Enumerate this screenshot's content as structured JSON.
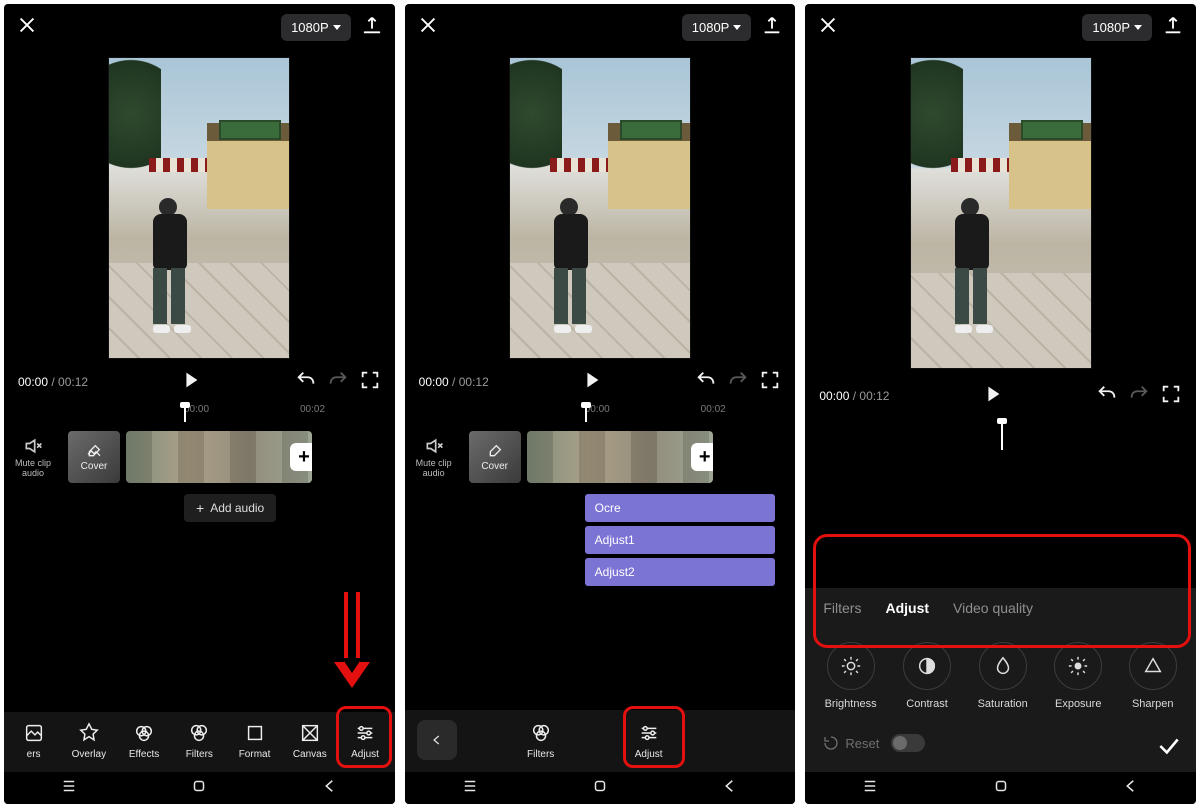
{
  "common": {
    "resolution": "1080P",
    "time_current": "00:00",
    "time_total": "00:12",
    "ruler_t1": "00:00",
    "ruler_t2": "00:02",
    "mute_label": "Mute clip audio",
    "cover_label": "Cover",
    "add_audio": "Add audio",
    "nav": {
      "recents": "recents",
      "home": "home",
      "back": "back"
    }
  },
  "panel1": {
    "tools": [
      "ers",
      "Overlay",
      "Effects",
      "Filters",
      "Format",
      "Canvas",
      "Adjust"
    ]
  },
  "panel2": {
    "tracks": [
      "Ocre",
      "Adjust1",
      "Adjust2"
    ],
    "tools": [
      "Filters",
      "Adjust"
    ]
  },
  "panel3": {
    "tabs": {
      "filters": "Filters",
      "adjust": "Adjust",
      "vq": "Video quality"
    },
    "options": [
      "Brightness",
      "Contrast",
      "Saturation",
      "Exposure",
      "Sharpen"
    ],
    "reset": "Reset"
  }
}
